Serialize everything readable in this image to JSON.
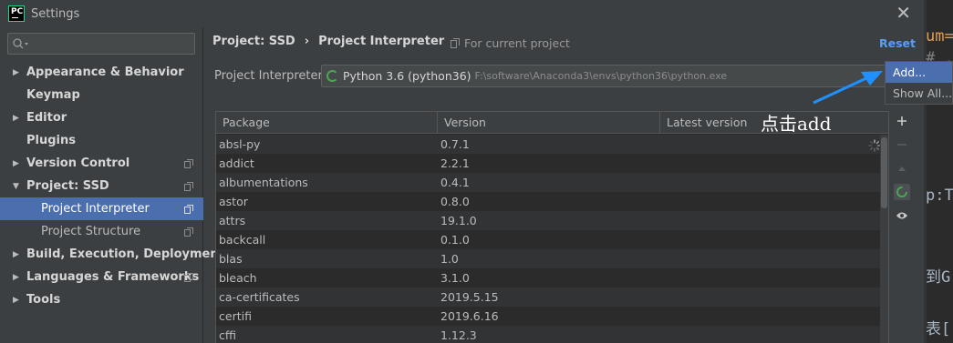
{
  "window": {
    "title": "Settings",
    "app_logo_text": "PC"
  },
  "sidebar": {
    "search": {
      "value": "",
      "placeholder": ""
    },
    "items": [
      {
        "label": "Appearance & Behavior",
        "expandable": true,
        "expanded": false,
        "level": 0,
        "has_copy_icon": false
      },
      {
        "label": "Keymap",
        "expandable": false,
        "level": 0,
        "has_copy_icon": false
      },
      {
        "label": "Editor",
        "expandable": true,
        "expanded": false,
        "level": 0,
        "has_copy_icon": false
      },
      {
        "label": "Plugins",
        "expandable": false,
        "level": 0,
        "has_copy_icon": false
      },
      {
        "label": "Version Control",
        "expandable": true,
        "expanded": false,
        "level": 0,
        "has_copy_icon": true
      },
      {
        "label": "Project: SSD",
        "expandable": true,
        "expanded": true,
        "level": 0,
        "has_copy_icon": true
      },
      {
        "label": "Project Interpreter",
        "expandable": false,
        "level": 1,
        "has_copy_icon": true,
        "selected": true
      },
      {
        "label": "Project Structure",
        "expandable": false,
        "level": 1,
        "has_copy_icon": true
      },
      {
        "label": "Build, Execution, Deployment",
        "expandable": true,
        "expanded": false,
        "level": 0,
        "has_copy_icon": false
      },
      {
        "label": "Languages & Frameworks",
        "expandable": true,
        "expanded": false,
        "level": 0,
        "has_copy_icon": true
      },
      {
        "label": "Tools",
        "expandable": true,
        "expanded": false,
        "level": 0,
        "has_copy_icon": false
      }
    ]
  },
  "main": {
    "breadcrumb": {
      "project": "Project: SSD",
      "separator": "›",
      "page": "Project Interpreter"
    },
    "for_current_project": "For current project",
    "reset_label": "Reset",
    "interpreter": {
      "label": "Project Interpreter:",
      "name": "Python 3.6 (python36)",
      "path": "F:\\software\\Anaconda3\\envs\\python36\\python.exe"
    },
    "table": {
      "columns": [
        "Package",
        "Version",
        "Latest version"
      ],
      "rows": [
        [
          "absl-py",
          "0.7.1",
          ""
        ],
        [
          "addict",
          "2.2.1",
          ""
        ],
        [
          "albumentations",
          "0.4.1",
          ""
        ],
        [
          "astor",
          "0.8.0",
          ""
        ],
        [
          "attrs",
          "19.1.0",
          ""
        ],
        [
          "backcall",
          "0.1.0",
          ""
        ],
        [
          "blas",
          "1.0",
          ""
        ],
        [
          "bleach",
          "3.1.0",
          ""
        ],
        [
          "ca-certificates",
          "2019.5.15",
          ""
        ],
        [
          "certifi",
          "2019.6.16",
          ""
        ],
        [
          "cffi",
          "1.12.3",
          ""
        ]
      ]
    },
    "toolbar": {
      "add_icon": "plus-icon",
      "remove_icon": "minus-icon",
      "upgrade_icon": "triangle-up-icon",
      "conda_icon": "conda-refresh-icon",
      "show_icon": "eye-icon"
    }
  },
  "popup": {
    "items": [
      "Add...",
      "Show All..."
    ],
    "highlighted": 0
  },
  "annotation": {
    "text": "点击add",
    "arrow_color": "#1e90ff"
  },
  "background_editor": {
    "lines": [
      "um=",
      "# .",
      "p:T",
      "到G",
      "表[:"
    ]
  },
  "colors": {
    "accent": "#4b6eaf",
    "link": "#589df6",
    "conda_green": "#49a652",
    "panel": "#3c3f41",
    "table": "#2b2b2b"
  }
}
